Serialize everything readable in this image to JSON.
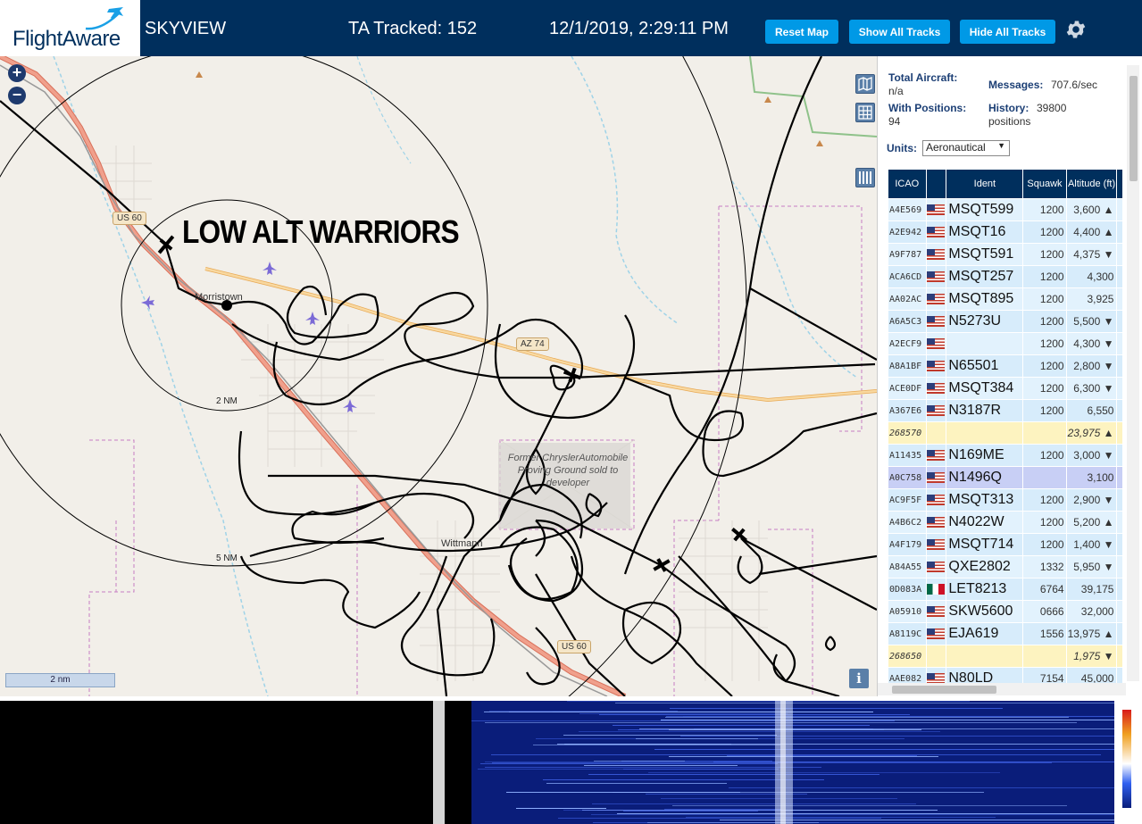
{
  "header": {
    "logo_text": "FlightAware",
    "app_title": "SKYVIEW",
    "tracked_text": "TA Tracked: 152",
    "datetime": "12/1/2019, 2:29:11 PM",
    "reset_map_label": "Reset Map",
    "show_all_label": "Show All Tracks",
    "hide_all_label": "Hide All Tracks",
    "settings_icon": "gear-icon"
  },
  "map": {
    "zoom_in_label": "+",
    "zoom_out_label": "−",
    "overlay_text": "LOW ALT WARRIORS",
    "place_labels": {
      "morristown": "Morristown",
      "wittmann": "Wittmann"
    },
    "former_site_text": "Former ChryslerAutomobile Proving Ground sold to developer",
    "range_labels": {
      "ring_2nm": "2 NM",
      "ring_5nm": "5 NM"
    },
    "road_labels": {
      "us60_north": "US 60",
      "az74": "AZ 74",
      "us60_south": "US 60"
    },
    "scale_label": "2 nm",
    "info_label": "i",
    "colors": {
      "land": "#f2efe9",
      "highway": "#e8927c",
      "state_route": "#f4c27f",
      "track": "#000000",
      "boundary": "#c77ec2",
      "water": "#9fd3e8"
    }
  },
  "sidebar": {
    "total_aircraft_label": "Total Aircraft:",
    "total_aircraft_value": "n/a",
    "messages_label": "Messages:",
    "messages_value": "707.6/sec",
    "with_positions_label": "With Positions:",
    "with_positions_value": "94",
    "history_label": "History:",
    "history_value": "39800",
    "history_unit": "positions",
    "units_label": "Units:",
    "units_value": "Aeronautical",
    "columns": [
      "ICAO",
      "",
      "Ident",
      "Squawk",
      "Altitude (ft)"
    ],
    "rows": [
      {
        "icao": "A4E569",
        "flag": "us",
        "ident": "MSQT599",
        "squawk": "1200",
        "alt": "3,600 ▲",
        "kind": "normal"
      },
      {
        "icao": "A2E942",
        "flag": "us",
        "ident": "MSQT16",
        "squawk": "1200",
        "alt": "4,400 ▲",
        "kind": "normal"
      },
      {
        "icao": "A9F787",
        "flag": "us",
        "ident": "MSQT591",
        "squawk": "1200",
        "alt": "4,375 ▼",
        "kind": "normal"
      },
      {
        "icao": "ACA6CD",
        "flag": "us",
        "ident": "MSQT257",
        "squawk": "1200",
        "alt": "4,300",
        "kind": "normal"
      },
      {
        "icao": "AA02AC",
        "flag": "us",
        "ident": "MSQT895",
        "squawk": "1200",
        "alt": "3,925",
        "kind": "normal"
      },
      {
        "icao": "A6A5C3",
        "flag": "us",
        "ident": "N5273U",
        "squawk": "1200",
        "alt": "5,500 ▼",
        "kind": "normal"
      },
      {
        "icao": "A2ECF9",
        "flag": "us",
        "ident": "",
        "squawk": "1200",
        "alt": "4,300 ▼",
        "kind": "normal"
      },
      {
        "icao": "A8A1BF",
        "flag": "us",
        "ident": "N65501",
        "squawk": "1200",
        "alt": "2,800 ▼",
        "kind": "normal"
      },
      {
        "icao": "ACE0DF",
        "flag": "us",
        "ident": "MSQT384",
        "squawk": "1200",
        "alt": "6,300 ▼",
        "kind": "normal"
      },
      {
        "icao": "A367E6",
        "flag": "us",
        "ident": "N3187R",
        "squawk": "1200",
        "alt": "6,550",
        "kind": "normal"
      },
      {
        "icao": "268570",
        "flag": "",
        "ident": "",
        "squawk": "",
        "alt": "23,975 ▲",
        "kind": "tisb"
      },
      {
        "icao": "A11435",
        "flag": "us",
        "ident": "N169ME",
        "squawk": "1200",
        "alt": "3,000 ▼",
        "kind": "normal"
      },
      {
        "icao": "A0C758",
        "flag": "us",
        "ident": "N1496Q",
        "squawk": "",
        "alt": "3,100",
        "kind": "selected"
      },
      {
        "icao": "AC9F5F",
        "flag": "us",
        "ident": "MSQT313",
        "squawk": "1200",
        "alt": "2,900 ▼",
        "kind": "normal"
      },
      {
        "icao": "A4B6C2",
        "flag": "us",
        "ident": "N4022W",
        "squawk": "1200",
        "alt": "5,200 ▲",
        "kind": "normal"
      },
      {
        "icao": "A4F179",
        "flag": "us",
        "ident": "MSQT714",
        "squawk": "1200",
        "alt": "1,400 ▼",
        "kind": "normal"
      },
      {
        "icao": "A84A55",
        "flag": "us",
        "ident": "QXE2802",
        "squawk": "1332",
        "alt": "5,950 ▼",
        "kind": "normal"
      },
      {
        "icao": "0D083A",
        "flag": "mx",
        "ident": "LET8213",
        "squawk": "6764",
        "alt": "39,175",
        "kind": "normal"
      },
      {
        "icao": "A05910",
        "flag": "us",
        "ident": "SKW5600",
        "squawk": "0666",
        "alt": "32,000",
        "kind": "normal"
      },
      {
        "icao": "A8119C",
        "flag": "us",
        "ident": "EJA619",
        "squawk": "1556",
        "alt": "13,975 ▲",
        "kind": "normal"
      },
      {
        "icao": "268650",
        "flag": "",
        "ident": "",
        "squawk": "",
        "alt": "1,975 ▼",
        "kind": "tisb"
      },
      {
        "icao": "AAE082",
        "flag": "us",
        "ident": "N80LD",
        "squawk": "7154",
        "alt": "45,000",
        "kind": "normal"
      }
    ]
  },
  "icons": {
    "layers": "map-layers-icon",
    "grid": "grid-icon",
    "columns": "columns-icon"
  }
}
